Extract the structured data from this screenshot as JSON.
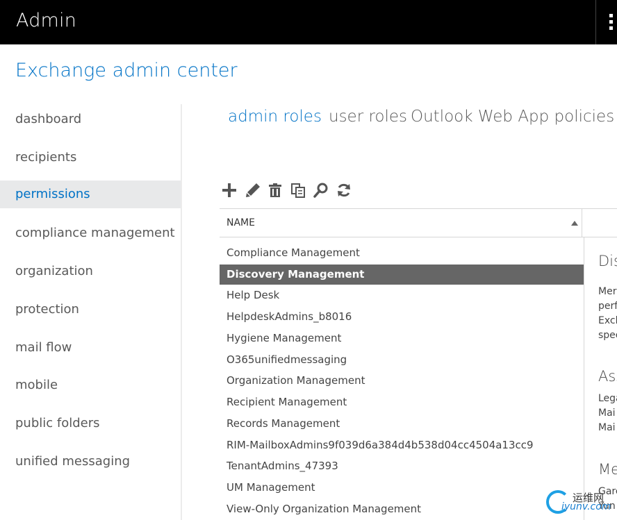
{
  "header": {
    "app_title": "Admin"
  },
  "center_title": "Exchange admin center",
  "nav": {
    "items": [
      {
        "label": "dashboard"
      },
      {
        "label": "recipients"
      },
      {
        "label": "permissions"
      },
      {
        "label": "compliance management"
      },
      {
        "label": "organization"
      },
      {
        "label": "protection"
      },
      {
        "label": "mail flow"
      },
      {
        "label": "mobile"
      },
      {
        "label": "public folders"
      },
      {
        "label": "unified messaging"
      }
    ],
    "selected": "permissions"
  },
  "tabs": [
    {
      "label": "admin roles"
    },
    {
      "label": "user roles"
    },
    {
      "label": "Outlook Web App policies"
    }
  ],
  "active_tab": "admin roles",
  "toolbar": {
    "icons": [
      "add-icon",
      "edit-icon",
      "delete-icon",
      "copy-icon",
      "search-icon",
      "refresh-icon"
    ]
  },
  "grid": {
    "column_name": "NAME",
    "sort": "ascending",
    "rows": [
      "Compliance Management",
      "Discovery Management",
      "Help Desk",
      "HelpdeskAdmins_b8016",
      "Hygiene Management",
      "O365unifiedmessaging",
      "Organization Management",
      "Recipient Management",
      "Records Management",
      "RIM-MailboxAdmins9f039d6a384d4b538d04cc4504a13cc9",
      "TenantAdmins_47393",
      "UM Management",
      "View-Only Organization Management"
    ],
    "selected_row": "Discovery Management"
  },
  "details": {
    "title": "Dis",
    "desc_lines": [
      "Mer",
      "perf",
      "Exch",
      "spec"
    ],
    "assigned_heading": "Ass",
    "assigned_lines": [
      "Lega",
      "Mai",
      "Mai"
    ],
    "members_heading": "Me",
    "members_lines": [
      "Garc",
      "Yun"
    ]
  },
  "watermark": {
    "cn": "运维网",
    "url": "iyunv.com"
  },
  "colors": {
    "accent": "#0072c6",
    "topbar": "#000000",
    "selected_row": "#666666",
    "nav_selected_bg": "#e8e9ea"
  }
}
